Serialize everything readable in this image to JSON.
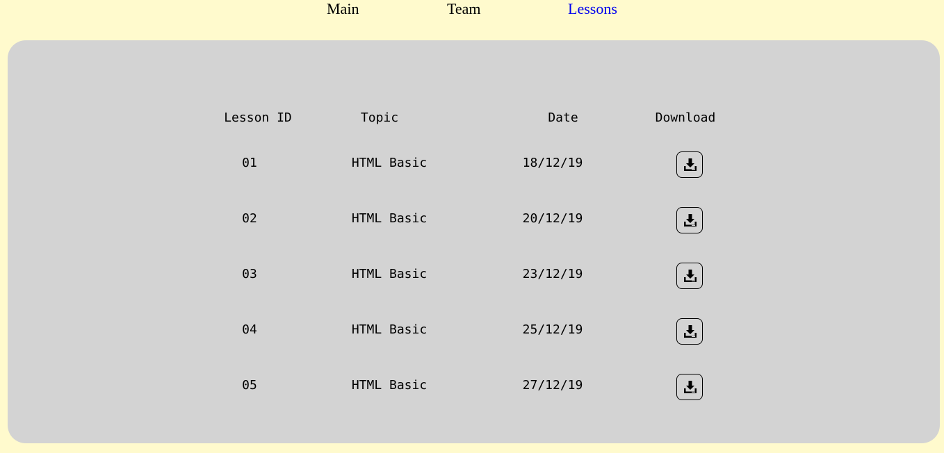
{
  "nav": {
    "items": [
      {
        "label": "Main",
        "active": false
      },
      {
        "label": "Team",
        "active": false
      },
      {
        "label": "Lessons",
        "active": true
      }
    ],
    "active_color": "#0000ee"
  },
  "colors": {
    "page_background": "#fffacd",
    "panel_background": "#d3d3d3"
  },
  "table": {
    "headers": {
      "id": "Lesson ID",
      "topic": "Topic",
      "date": "Date",
      "download": "Download"
    },
    "rows": [
      {
        "id": "01",
        "topic": "HTML Basic",
        "date": "18/12/19",
        "download_icon": "download-icon"
      },
      {
        "id": "02",
        "topic": "HTML Basic",
        "date": "20/12/19",
        "download_icon": "download-icon"
      },
      {
        "id": "03",
        "topic": "HTML Basic",
        "date": "23/12/19",
        "download_icon": "download-icon"
      },
      {
        "id": "04",
        "topic": "HTML Basic",
        "date": "25/12/19",
        "download_icon": "download-icon"
      },
      {
        "id": "05",
        "topic": "HTML Basic",
        "date": "27/12/19",
        "download_icon": "download-icon"
      }
    ]
  }
}
